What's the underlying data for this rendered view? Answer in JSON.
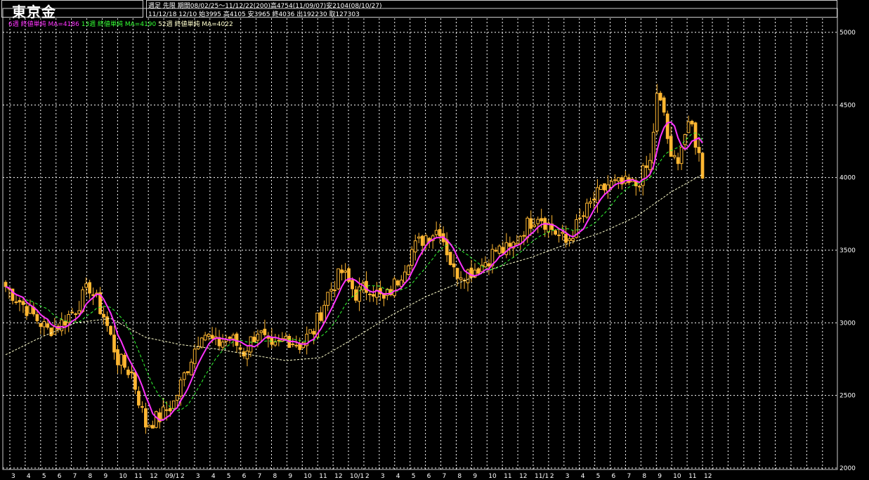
{
  "header": {
    "title": "東京金",
    "line1_mode": "週足",
    "line1_type": "先限",
    "line1_period": "期間08/02/25〜11/12/22(200)",
    "line1_high": "高4754(11/09/07)",
    "line1_low": "安2104(08/10/27)",
    "line2_range": "11/12/18 12/10",
    "line2_open": "始3995",
    "line2_high": "高4105",
    "line2_low": "安3965",
    "line2_close": "終4036",
    "line2_volume": "出192230",
    "line2_oi": "取127303"
  },
  "legend": {
    "ma6": "6週 終値単純 MA=4186",
    "ma13": "13週 終値単純 MA=4190",
    "ma52": "52週 終値単純 MA=4022"
  },
  "colors": {
    "background": "#000000",
    "grid": "#ffffff",
    "candle": "#ffb732",
    "ma6": "#ff33ff",
    "ma13": "#33ff33",
    "ma52": "#ffffcc"
  },
  "chart_data": {
    "type": "candlestick",
    "y_ticks": [
      "5000",
      "4500",
      "4000",
      "3500",
      "3000",
      "2500",
      "2000"
    ],
    "ylim": [
      2000,
      5000
    ],
    "x_labels": [
      "3",
      "4",
      "5",
      "6",
      "7",
      "8",
      "9",
      "10",
      "11",
      "12",
      "09/1",
      "2",
      "3",
      "4",
      "5",
      "6",
      "7",
      "8",
      "9",
      "10",
      "11",
      "12",
      "10/1",
      "2",
      "3",
      "4",
      "5",
      "6",
      "7",
      "8",
      "9",
      "10",
      "11",
      "12",
      "11/1",
      "2",
      "3",
      "4",
      "5",
      "6",
      "7",
      "8",
      "9",
      "10",
      "11",
      "12"
    ],
    "weeks": 200,
    "ohlc_series": "weekly OHLC, 08/02/25 – 11/12/22",
    "ma_series": [
      {
        "name": "6週 終値単純",
        "ref": "ma6"
      },
      {
        "name": "13週 終値単純",
        "ref": "ma13"
      },
      {
        "name": "52週 終値単純",
        "ref": "ma52"
      }
    ],
    "close_path": [
      [
        0,
        3250
      ],
      [
        4,
        3150
      ],
      [
        8,
        3050
      ],
      [
        12,
        2950
      ],
      [
        16,
        3000
      ],
      [
        20,
        3100
      ],
      [
        24,
        3250
      ],
      [
        28,
        3050
      ],
      [
        32,
        2750
      ],
      [
        36,
        2650
      ],
      [
        40,
        2300
      ],
      [
        44,
        2350
      ],
      [
        48,
        2450
      ],
      [
        52,
        2700
      ],
      [
        56,
        2950
      ],
      [
        60,
        2850
      ],
      [
        64,
        2900
      ],
      [
        68,
        2800
      ],
      [
        72,
        2950
      ],
      [
        76,
        2800
      ],
      [
        80,
        2900
      ],
      [
        84,
        2850
      ],
      [
        88,
        2950
      ],
      [
        92,
        3200
      ],
      [
        96,
        3350
      ],
      [
        100,
        3200
      ],
      [
        104,
        3250
      ],
      [
        108,
        3150
      ],
      [
        112,
        3300
      ],
      [
        116,
        3500
      ],
      [
        120,
        3600
      ],
      [
        124,
        3650
      ],
      [
        128,
        3350
      ],
      [
        132,
        3350
      ],
      [
        136,
        3400
      ],
      [
        140,
        3500
      ],
      [
        144,
        3500
      ],
      [
        148,
        3650
      ],
      [
        152,
        3750
      ],
      [
        156,
        3650
      ],
      [
        160,
        3550
      ],
      [
        164,
        3700
      ],
      [
        168,
        3850
      ],
      [
        172,
        3950
      ],
      [
        176,
        3950
      ],
      [
        180,
        3950
      ],
      [
        184,
        4100
      ],
      [
        186,
        4550
      ],
      [
        188,
        4450
      ],
      [
        190,
        4100
      ],
      [
        192,
        4150
      ],
      [
        194,
        4300
      ],
      [
        196,
        4350
      ],
      [
        198,
        4150
      ],
      [
        199,
        4036
      ]
    ],
    "ma52_path": [
      [
        0,
        2780
      ],
      [
        10,
        2900
      ],
      [
        20,
        3000
      ],
      [
        30,
        3030
      ],
      [
        40,
        2900
      ],
      [
        50,
        2850
      ],
      [
        60,
        2820
      ],
      [
        70,
        2780
      ],
      [
        80,
        2740
      ],
      [
        90,
        2760
      ],
      [
        100,
        2900
      ],
      [
        110,
        3050
      ],
      [
        120,
        3180
      ],
      [
        130,
        3280
      ],
      [
        140,
        3380
      ],
      [
        150,
        3450
      ],
      [
        160,
        3540
      ],
      [
        170,
        3620
      ],
      [
        180,
        3730
      ],
      [
        190,
        3900
      ],
      [
        199,
        4022
      ]
    ]
  }
}
